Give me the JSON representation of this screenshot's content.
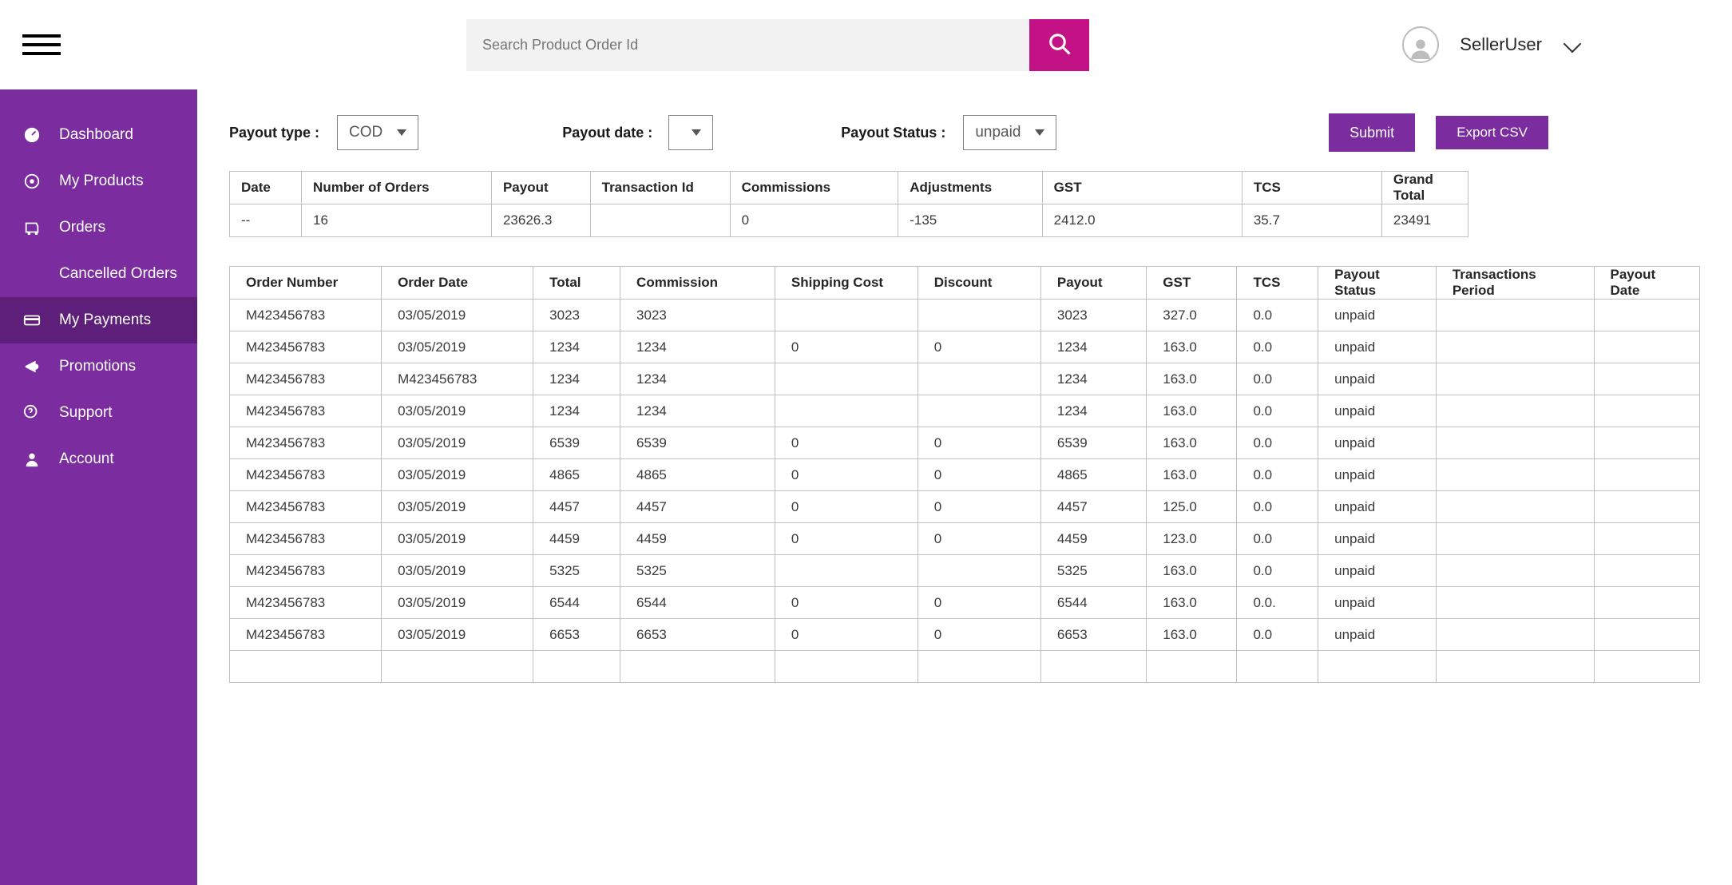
{
  "header": {
    "search_placeholder": "Search Product Order Id",
    "user_name": "SellerUser"
  },
  "sidebar": {
    "items": [
      {
        "label": "Dashboard"
      },
      {
        "label": "My Products"
      },
      {
        "label": "Orders"
      },
      {
        "label": "Cancelled Orders"
      },
      {
        "label": "My Payments"
      },
      {
        "label": "Promotions"
      },
      {
        "label": "Support"
      },
      {
        "label": "Account"
      }
    ]
  },
  "filters": {
    "payout_type_label": "Payout type :",
    "payout_type_value": "COD",
    "payout_date_label": "Payout date :",
    "payout_status_label": "Payout Status :",
    "payout_status_value": "unpaid",
    "submit_label": "Submit",
    "export_label": "Export CSV"
  },
  "summary": {
    "headers": [
      "Date",
      "Number of Orders",
      "Payout",
      "Transaction Id",
      "Commissions",
      "Adjustments",
      "GST",
      "TCS",
      "Grand Total"
    ],
    "row": [
      "--",
      "16",
      "23626.3",
      "",
      "0",
      "-135",
      "2412.0",
      "35.7",
      "23491"
    ]
  },
  "orders": {
    "headers": [
      "Order Number",
      "Order Date",
      "Total",
      "Commission",
      "Shipping Cost",
      "Discount",
      "Payout",
      "GST",
      "TCS",
      "Payout Status",
      "Transactions  Period",
      "Payout Date"
    ],
    "rows": [
      [
        "M423456783",
        "03/05/2019",
        "3023",
        "3023",
        "",
        "",
        "3023",
        "327.0",
        "0.0",
        "unpaid",
        "",
        ""
      ],
      [
        "M423456783",
        "03/05/2019",
        "1234",
        "1234",
        "0",
        "0",
        "1234",
        "163.0",
        "0.0",
        "unpaid",
        "",
        ""
      ],
      [
        "M423456783",
        "M423456783",
        "1234",
        "1234",
        "",
        "",
        "1234",
        "163.0",
        "0.0",
        "unpaid",
        "",
        ""
      ],
      [
        "M423456783",
        "03/05/2019",
        "1234",
        "1234",
        "",
        "",
        "1234",
        "163.0",
        "0.0",
        "unpaid",
        "",
        ""
      ],
      [
        "M423456783",
        "03/05/2019",
        "6539",
        "6539",
        "0",
        "0",
        "6539",
        "163.0",
        "0.0",
        "unpaid",
        "",
        ""
      ],
      [
        "M423456783",
        "03/05/2019",
        "4865",
        "4865",
        "0",
        "0",
        "4865",
        "163.0",
        "0.0",
        "unpaid",
        "",
        ""
      ],
      [
        "M423456783",
        "03/05/2019",
        "4457",
        "4457",
        "0",
        "0",
        "4457",
        "125.0",
        "0.0",
        "unpaid",
        "",
        ""
      ],
      [
        "M423456783",
        "03/05/2019",
        "4459",
        "4459",
        "0",
        "0",
        "4459",
        "123.0",
        "0.0",
        "unpaid",
        "",
        ""
      ],
      [
        "M423456783",
        "03/05/2019",
        "5325",
        "5325",
        "",
        "",
        "5325",
        "163.0",
        "0.0",
        "unpaid",
        "",
        ""
      ],
      [
        "M423456783",
        "03/05/2019",
        "6544",
        "6544",
        "0",
        "0",
        "6544",
        "163.0",
        "0.0.",
        "unpaid",
        "",
        ""
      ],
      [
        "M423456783",
        "03/05/2019",
        "6653",
        "6653",
        "0",
        "0",
        "6653",
        "163.0",
        "0.0",
        "unpaid",
        "",
        ""
      ]
    ]
  }
}
